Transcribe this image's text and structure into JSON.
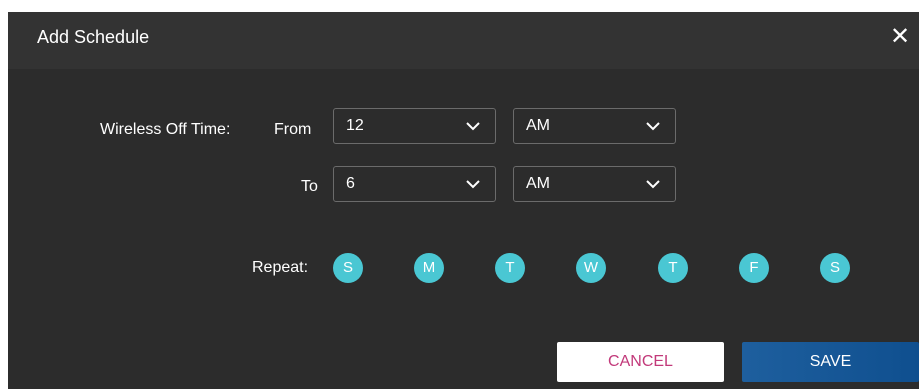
{
  "dialog": {
    "title": "Add Schedule",
    "close_icon": "close-icon"
  },
  "form": {
    "wireless_off_label": "Wireless Off Time:",
    "from_label": "From",
    "to_label": "To",
    "from_hour": "12",
    "from_period": "AM",
    "to_hour": "6",
    "to_period": "AM",
    "repeat_label": "Repeat:",
    "days": [
      "S",
      "M",
      "T",
      "W",
      "T",
      "F",
      "S"
    ]
  },
  "buttons": {
    "cancel": "CANCEL",
    "save": "SAVE"
  },
  "colors": {
    "day_circle": "#4ac7d3",
    "cancel_text": "#c2397a",
    "save_bg": "#1e5f9e",
    "dialog_bg": "#2c2c2c",
    "titlebar_bg": "#333333"
  }
}
